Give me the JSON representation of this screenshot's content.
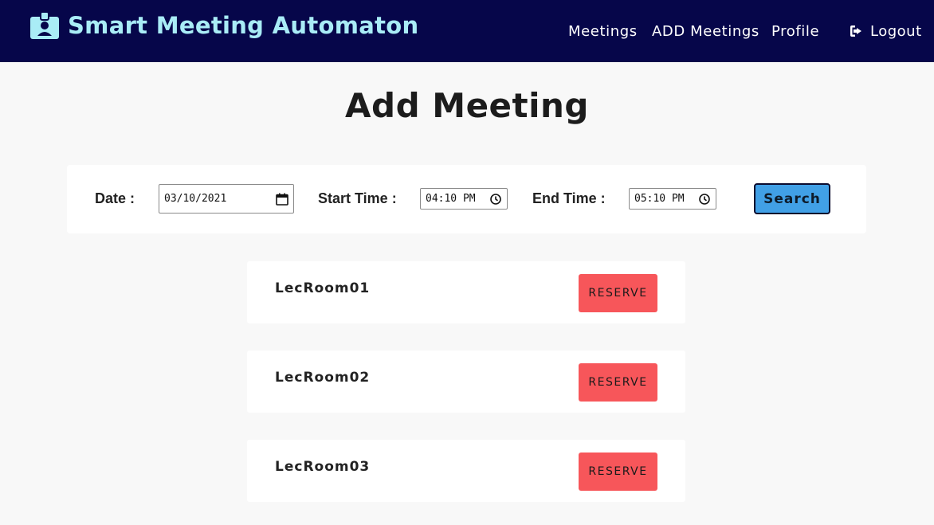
{
  "header": {
    "brand_icon": "id-badge-icon",
    "title": "Smart Meeting Automaton",
    "nav": [
      "Meetings",
      "ADD Meetings",
      "Profile"
    ],
    "logout_label": "Logout",
    "logout_icon": "sign-out-icon",
    "colors": {
      "background": "#06064a",
      "title": "#a9ecf6"
    }
  },
  "main": {
    "title": "Add Meeting"
  },
  "search": {
    "date_label": "Date :",
    "date_value": "03/10/2021",
    "start_label": "Start Time :",
    "start_value": "04:10 PM",
    "end_label": "End Time :",
    "end_value": "05:10 PM",
    "button_label": "Search",
    "button_color": "#41a0e6"
  },
  "rooms": [
    {
      "name": "LecRoom01",
      "action": "RESERVE"
    },
    {
      "name": "LecRoom02",
      "action": "RESERVE"
    },
    {
      "name": "LecRoom03",
      "action": "RESERVE"
    }
  ],
  "reserve_color": "#f7565a"
}
